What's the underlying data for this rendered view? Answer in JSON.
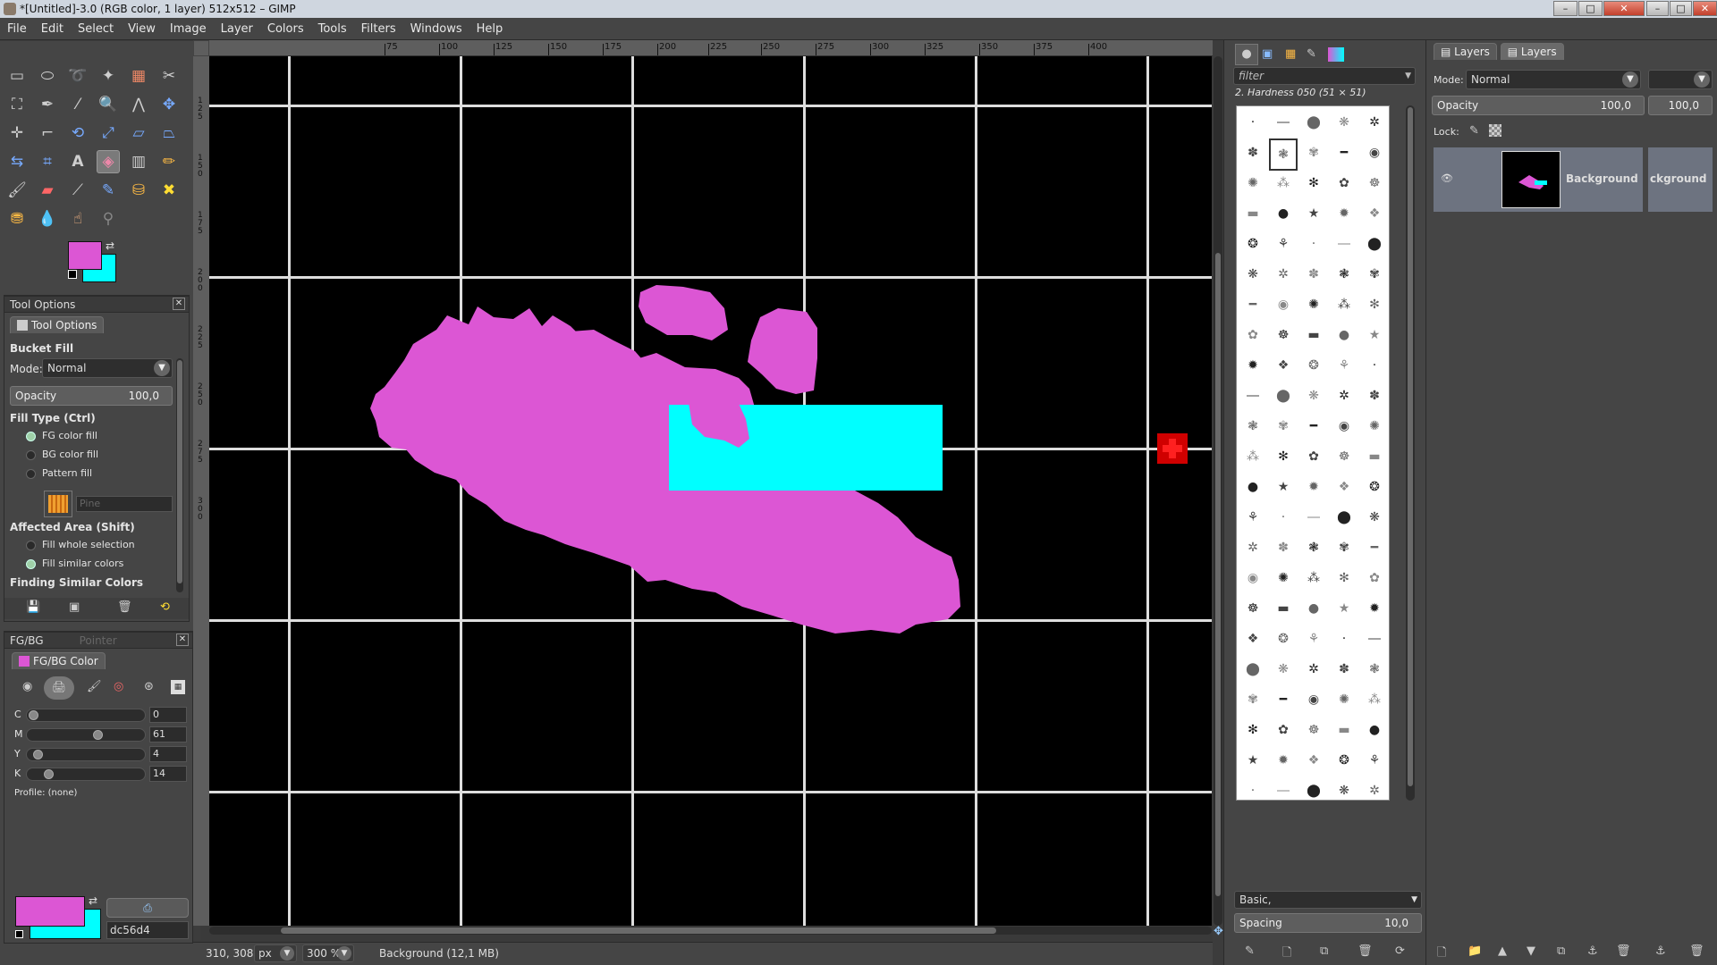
{
  "window": {
    "title": "*[Untitled]-3.0 (RGB color, 1 layer) 512x512 – GIMP"
  },
  "menu": [
    "File",
    "Edit",
    "Select",
    "View",
    "Image",
    "Layer",
    "Colors",
    "Tools",
    "Filters",
    "Windows",
    "Help"
  ],
  "toolbox": {
    "fg_color": "#dc56d4",
    "bg_color": "#00ffff"
  },
  "tool_options": {
    "dock_title": "Tool Options",
    "tab_label": "Tool Options",
    "tool_name": "Bucket Fill",
    "mode_label": "Mode:",
    "mode_value": "Normal",
    "opacity_label": "Opacity",
    "opacity_value": "100,0",
    "fill_type_label": "Fill Type  (Ctrl)",
    "fill_types": [
      "FG color fill",
      "BG color fill",
      "Pattern fill"
    ],
    "pattern_name": "Pine",
    "affected_label": "Affected Area  (Shift)",
    "affected": [
      "Fill whole selection",
      "Fill similar colors"
    ],
    "finding_label": "Finding Similar Colors"
  },
  "fgbg": {
    "dock_title": "FG/BG",
    "dock_tab2": "Pointer",
    "tab_label": "FG/BG Color",
    "channels": [
      {
        "name": "C",
        "value": "0",
        "pos": 0
      },
      {
        "name": "M",
        "value": "61",
        "pos": 0.61
      },
      {
        "name": "Y",
        "value": "4",
        "pos": 0.04
      },
      {
        "name": "K",
        "value": "14",
        "pos": 0.14
      }
    ],
    "profile": "Profile: (none)",
    "hex": "dc56d4"
  },
  "ruler": {
    "h_ticks": [
      "75",
      "100",
      "125",
      "150",
      "175",
      "200",
      "225",
      "250",
      "275",
      "300",
      "325",
      "350",
      "375",
      "400"
    ],
    "v_ticks": [
      "1\n2\n5",
      "1\n5\n0",
      "1\n7\n5",
      "2\n0\n0",
      "2\n2\n5",
      "2\n5\n0",
      "2\n7\n5",
      "3\n0\n0"
    ]
  },
  "status": {
    "coords": "310, 308",
    "unit": "px",
    "zoom": "300 %",
    "info": "Background (12,1 MB)"
  },
  "brushes": {
    "filter_placeholder": "filter",
    "selected": "2. Hardness 050 (51 × 51)",
    "category": "Basic,",
    "spacing_label": "Spacing",
    "spacing_value": "10,0"
  },
  "layers": {
    "tab1": "Layers",
    "tab2": "Layers",
    "mode_label": "Mode:",
    "mode_value": "Normal",
    "opacity_label": "Opacity",
    "opacity_value": "100,0",
    "opacity_value2": "100,0",
    "lock_label": "Lock:",
    "layer_name": "Background",
    "layer_name_clipped": "ckground"
  }
}
